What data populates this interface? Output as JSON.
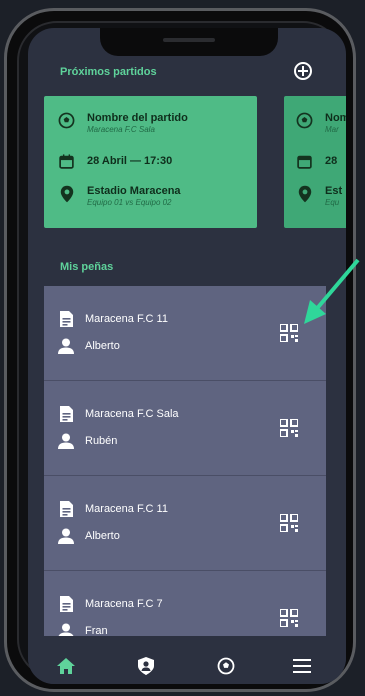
{
  "upcoming": {
    "title": "Próximos partidos",
    "card": {
      "name": "Nombre del partido",
      "club": "Maracena F.C Sala",
      "date": "28 Abril — 17:30",
      "venue": "Estadio Maracena",
      "teams": "Equipo 01 vs Equipo 02"
    },
    "card_partial": {
      "name": "Nom",
      "club": "Mar",
      "date": "28",
      "venue": "Est",
      "teams": "Equ"
    }
  },
  "penas": {
    "title": "Mis peñas",
    "items": [
      {
        "name": "Maracena F.C 11",
        "user": "Alberto"
      },
      {
        "name": "Maracena F.C Sala",
        "user": "Rubén"
      },
      {
        "name": "Maracena F.C 11",
        "user": "Alberto"
      },
      {
        "name": "Maracena F.C 7",
        "user": "Fran"
      }
    ]
  },
  "tabs": [
    {
      "icon": "home-icon",
      "active": true
    },
    {
      "icon": "user-shield-icon",
      "active": false
    },
    {
      "icon": "soccer-ball-icon",
      "active": false
    },
    {
      "icon": "menu-icon",
      "active": false
    }
  ],
  "colors": {
    "accent": "#5fd39b",
    "card": "#4fbb86",
    "list_bg": "#5f6480",
    "screen_bg": "#2c3140",
    "arrow": "#2fd79a"
  }
}
